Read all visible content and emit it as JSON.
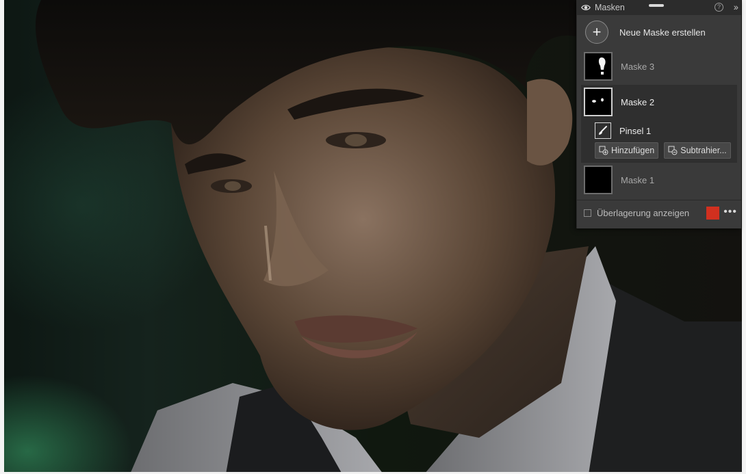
{
  "panel": {
    "title": "Masken",
    "new_mask_label": "Neue Maske erstellen",
    "masks": [
      {
        "name": "Maske 3"
      },
      {
        "name": "Maske 2",
        "active": true,
        "tool": "Pinsel 1"
      },
      {
        "name": "Maske 1"
      }
    ],
    "buttons": {
      "add": "Hinzufügen",
      "subtract": "Subtrahier..."
    },
    "overlay_label": "Überlagerung anzeigen",
    "overlay_checked": false,
    "overlay_color": "#d1301f"
  },
  "icons": [
    "eye-icon",
    "help-icon",
    "collapse-icon",
    "plus-icon",
    "brush-icon",
    "add-mask-icon",
    "subtract-mask-icon",
    "more-icon"
  ]
}
